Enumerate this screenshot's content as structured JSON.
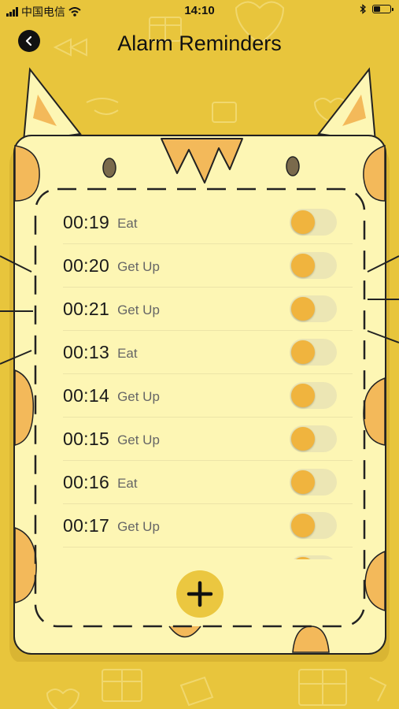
{
  "status_bar": {
    "carrier": "中国电信",
    "time": "14:10"
  },
  "nav": {
    "title": "Alarm Reminders",
    "back_icon": "back-arrow-icon"
  },
  "alarms": [
    {
      "time": "00:19",
      "label": "Eat",
      "enabled": true
    },
    {
      "time": "00:20",
      "label": "Get Up",
      "enabled": true
    },
    {
      "time": "00:21",
      "label": "Get Up",
      "enabled": true
    },
    {
      "time": "00:13",
      "label": "Eat",
      "enabled": true
    },
    {
      "time": "00:14",
      "label": "Get Up",
      "enabled": true
    },
    {
      "time": "00:15",
      "label": "Get Up",
      "enabled": true
    },
    {
      "time": "00:16",
      "label": "Eat",
      "enabled": true
    },
    {
      "time": "00:17",
      "label": "Get Up",
      "enabled": true
    }
  ],
  "add_button": {
    "icon": "plus-icon"
  },
  "colors": {
    "background": "#e8c53c",
    "card": "#fdf6b4",
    "accent": "#f0b43e",
    "text": "#1a1a1a"
  }
}
